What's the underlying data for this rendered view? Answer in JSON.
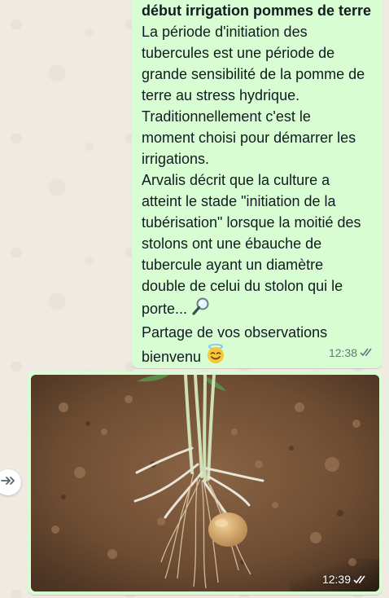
{
  "text_message": {
    "title": "début irrigation pommes de terre",
    "lines": [
      "La période d'initiation des",
      "tubercules est une période de",
      "grande sensibilité de la pomme de",
      "terre au stress hydrique.",
      "Traditionnellement c'est le",
      "moment choisi pour démarrer les",
      "irrigations.",
      "Arvalis décrit que la culture a",
      "atteint le stade \"initiation de la",
      "tubérisation\" lorsque la moitié des",
      "stolons ont une ébauche de",
      "tubercule ayant un diamètre",
      "double de celui du stolon qui le",
      "porte...",
      "Partage de vos observations",
      "bienvenu"
    ],
    "line_emojis": {
      "13": "magnifying-glass-icon",
      "15": "smiling-face-with-halo-icon"
    },
    "time": "12:38",
    "status_icon": "double-check-read-icon"
  },
  "image_message": {
    "image_subject": "potato plant with stolons and tuber on soil",
    "time": "12:39",
    "status_icon": "double-check-read-icon"
  },
  "forward_button": {
    "icon": "forward-arrows-icon"
  },
  "colors": {
    "chat_background": "#efeae2",
    "outgoing_bubble": "#d9fdd3",
    "text": "#111b21",
    "meta": "#667781"
  }
}
